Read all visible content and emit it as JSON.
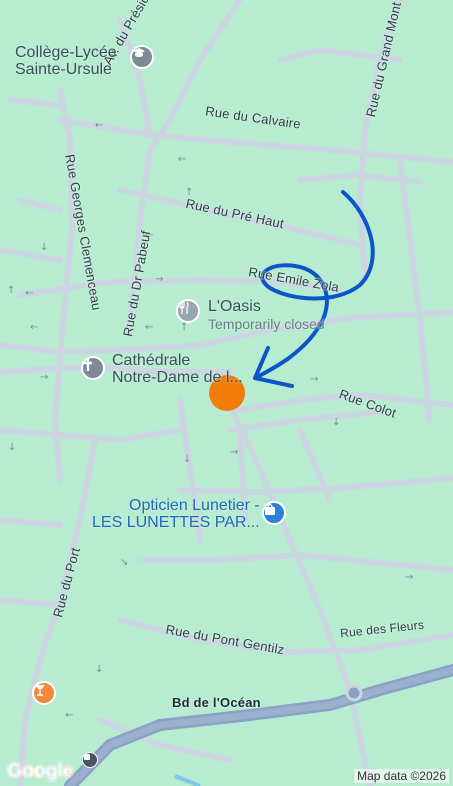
{
  "map": {
    "streets": {
      "president_wilson": "Av. du Président Wilson",
      "grand_mont": "Rue du Grand Mont",
      "calvaire": "Rue du Calvaire",
      "pre_haut": "Rue du Pré Haut",
      "emile_zola": "Rue Emile Zola",
      "georges_clemenceau": "Rue Georges Clemenceau",
      "dr_pabeuf": "Rue du Dr Pabeuf",
      "colot": "Rue Colot",
      "port": "Rue du Port",
      "pont_gentil": "Rue du Pont Gentilz",
      "fleurs": "Rue des Fleurs",
      "ocean": "Bd de l'Océan"
    },
    "pois": {
      "college": {
        "line1": "Collège-Lycée",
        "line2": "Sainte-Ursule",
        "icon": "school-icon"
      },
      "oasis": {
        "name": "L'Oasis",
        "status": "Temporarily closed",
        "icon": "restaurant-icon"
      },
      "cathedral": {
        "line1": "Cathédrale",
        "line2": "Notre-Dame de l...",
        "icon": "church-icon"
      },
      "opticien": {
        "line1": "Opticien Lunetier -",
        "line2": "LES LUNETTES PAR...",
        "icon": "shopping-bag-icon"
      },
      "bar": {
        "icon": "cocktail-icon"
      },
      "bus": {
        "icon": "bus-icon"
      }
    },
    "marker": {
      "color": "#f07c0a"
    },
    "annotation": {
      "color": "#0a55c9"
    },
    "colors": {
      "land": "#b7ecd0",
      "road": "#cfd8e4",
      "highway": "#8fa6c8"
    }
  },
  "footer": {
    "google": "Google",
    "attribution": "Map data ©2026"
  }
}
